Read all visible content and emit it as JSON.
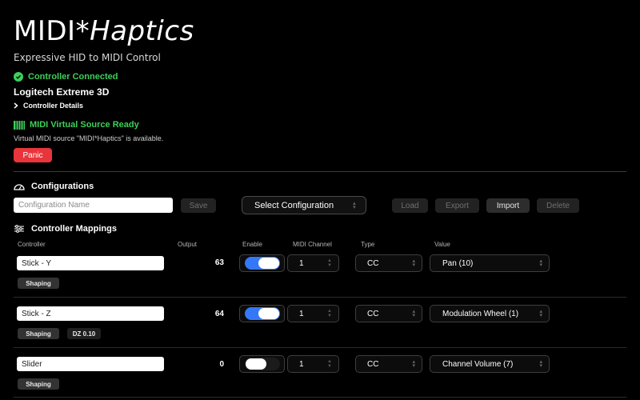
{
  "app": {
    "title_main": "MIDI*",
    "title_italic": "Haptics",
    "subtitle": "Expressive HID to MIDI Control"
  },
  "controller": {
    "status": "Controller Connected",
    "name": "Logitech Extreme 3D",
    "details_label": "Controller Details"
  },
  "midi": {
    "status": "MIDI Virtual Source Ready",
    "note": "Virtual MIDI source \"MIDI*Haptics\" is available."
  },
  "panic_label": "Panic",
  "configurations": {
    "heading": "Configurations",
    "name_placeholder": "Configuration Name",
    "save_label": "Save",
    "select_label": "Select Configuration",
    "load_label": "Load",
    "export_label": "Export",
    "import_label": "Import",
    "delete_label": "Delete"
  },
  "mappings": {
    "heading": "Controller Mappings",
    "columns": {
      "controller": "Controller",
      "output": "Output",
      "enable": "Enable",
      "channel": "MIDI Channel",
      "type": "Type",
      "value": "Value"
    },
    "rows": [
      {
        "controller": "Stick - Y",
        "output": "63",
        "enabled": true,
        "channel": "1",
        "type": "CC",
        "value": "Pan (10)",
        "shaping": "Shaping",
        "dz": ""
      },
      {
        "controller": "Stick - Z",
        "output": "64",
        "enabled": true,
        "channel": "1",
        "type": "CC",
        "value": "Modulation Wheel (1)",
        "shaping": "Shaping",
        "dz": "DZ 0.10"
      },
      {
        "controller": "Slider",
        "output": "0",
        "enabled": false,
        "channel": "1",
        "type": "CC",
        "value": "Channel Volume (7)",
        "shaping": "Shaping",
        "dz": ""
      }
    ]
  },
  "colors": {
    "accent_green": "#3ecf5a",
    "toggle_on": "#3478f6",
    "panic_red": "#e8353b"
  }
}
